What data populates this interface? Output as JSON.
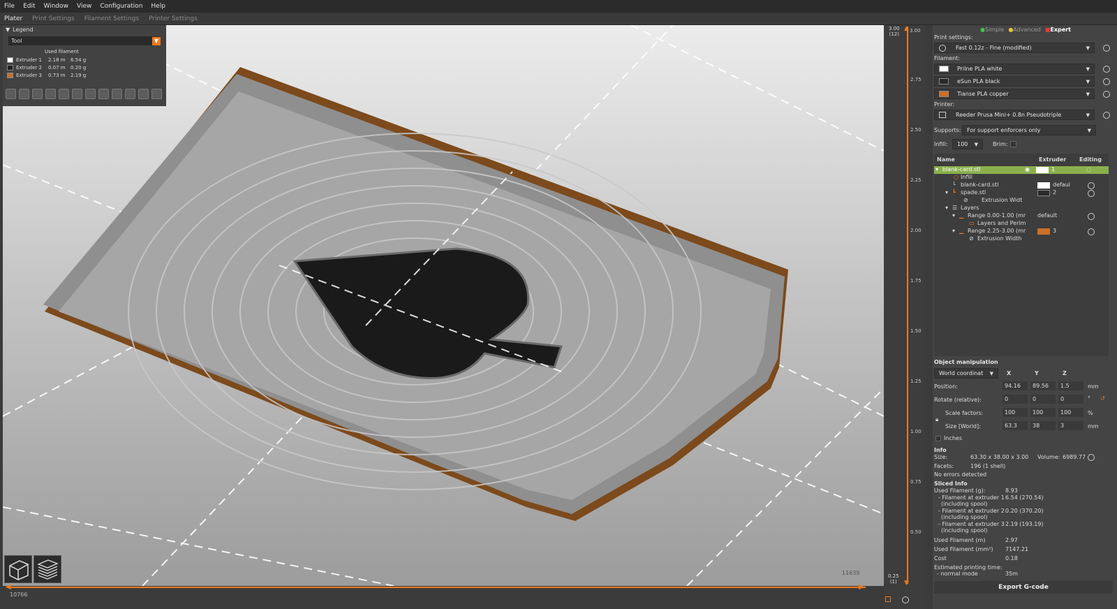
{
  "menu": [
    "File",
    "Edit",
    "Window",
    "View",
    "Configuration",
    "Help"
  ],
  "tabs": [
    "Plater",
    "Print Settings",
    "Filament Settings",
    "Printer Settings"
  ],
  "legend": {
    "title": "Legend",
    "view_type": "Tool",
    "used_filament_label": "Used filament",
    "extruders": [
      {
        "name": "Extruder 1",
        "length": "2.18 m",
        "weight": "6.54 g",
        "color": "#ffffff"
      },
      {
        "name": "Extruder 2",
        "length": "0.07 m",
        "weight": "0.20 g",
        "color": "#222222"
      },
      {
        "name": "Extruder 3",
        "length": "0.73 m",
        "weight": "2.19 g",
        "color": "#c8702a"
      }
    ]
  },
  "hslider": {
    "left_value": "10766",
    "right_value": "11639"
  },
  "vslider": {
    "top_value": "3.00",
    "top_layer": "(12)",
    "bottom_value": "0.25",
    "bottom_layer": "(1)",
    "ticks": [
      "3.00",
      "2.75",
      "2.50",
      "2.25",
      "2.00",
      "1.75",
      "1.50",
      "1.25",
      "1.00",
      "0.75",
      "0.50"
    ]
  },
  "modes": {
    "simple": "Simple",
    "advanced": "Advanced",
    "expert": "Expert",
    "colors": {
      "simple": "#43c443",
      "advanced": "#e8c33a",
      "expert": "#e33b3b"
    }
  },
  "print_settings": {
    "label": "Print settings:",
    "value": "Fast 0.12z - Fine (modified)"
  },
  "filament": {
    "label": "Filament:",
    "items": [
      {
        "name": "Prilne PLA white",
        "color": "#ffffff"
      },
      {
        "name": "eSun PLA black",
        "color": "#2a2a2a"
      },
      {
        "name": "Tianse PLA copper",
        "color": "#c8702a"
      }
    ]
  },
  "printer": {
    "label": "Printer:",
    "value": "Reeder Prusa Mini+ 0.8n Pseudotriple"
  },
  "supports": {
    "label": "Supports:",
    "value": "For support enforcers only"
  },
  "infill": {
    "label": "Infill:",
    "value": "100"
  },
  "brim": {
    "label": "Brim:"
  },
  "object_list": {
    "headers": [
      "Name",
      "Extruder",
      "Editing"
    ],
    "rows": [
      {
        "name": "blank-card.stl",
        "extruder": "1"
      },
      {
        "name": "Infill",
        "extruder": ""
      },
      {
        "name": "blank-card.stl",
        "extruder": "defaul"
      },
      {
        "name": "spade.stl",
        "extruder": "2"
      },
      {
        "name": "Extrusion Widt",
        "extruder": ""
      },
      {
        "name": "Layers",
        "extruder": ""
      },
      {
        "name": "Range 0.00-1.00 (mr",
        "extruder": "default"
      },
      {
        "name": "Layers and Perim",
        "extruder": ""
      },
      {
        "name": "Range 2.25-3.00 (mr",
        "extruder": "3"
      },
      {
        "name": "Extrusion Width",
        "extruder": ""
      }
    ]
  },
  "object_manipulation": {
    "title": "Object manipulation",
    "coord_system": "World coordinat",
    "axes": [
      "X",
      "Y",
      "Z"
    ],
    "position": {
      "label": "Position:",
      "values": [
        "94.16",
        "89.56",
        "1.5"
      ],
      "unit": "mm"
    },
    "rotate": {
      "label": "Rotate (relative):",
      "values": [
        "0",
        "0",
        "0"
      ],
      "unit": "°"
    },
    "scale": {
      "label": "Scale factors:",
      "values": [
        "100",
        "100",
        "100"
      ],
      "unit": "%"
    },
    "size": {
      "label": "Size [World]:",
      "values": [
        "63.3",
        "38",
        "3"
      ],
      "unit": "mm"
    },
    "inches_label": "Inches"
  },
  "info": {
    "title": "Info",
    "size_label": "Size:",
    "size_value": "63.30 x 38.00 x 3.00",
    "volume_label": "Volume:",
    "volume_value": "6989.77",
    "facets_label": "Facets:",
    "facets_value": "196 (1 shell)",
    "errors": "No errors detected"
  },
  "sliced_info": {
    "title": "Sliced Info",
    "rows": [
      {
        "label": "Used Filament (g):",
        "value": "8.93"
      },
      {
        "label": "- Filament at extruder 1",
        "value": "6.54 (270.54)"
      },
      {
        "label": "(including spool)",
        "value": ""
      },
      {
        "label": "- Filament at extruder 2",
        "value": "0.20 (370.20)"
      },
      {
        "label": "(including spool)",
        "value": ""
      },
      {
        "label": "- Filament at extruder 3",
        "value": "2.19 (193.19)"
      },
      {
        "label": "(including spool)",
        "value": ""
      },
      {
        "label": "Used Filament (m)",
        "value": "2.97"
      },
      {
        "label": "Used Filament (mm³)",
        "value": "7147.21"
      },
      {
        "label": "Cost",
        "value": "0.18"
      },
      {
        "label": "Estimated printing time:",
        "value": ""
      },
      {
        "label": "- normal mode",
        "value": "35m"
      }
    ]
  },
  "export_button": "Export G-code",
  "accent": "#ed7a1e"
}
